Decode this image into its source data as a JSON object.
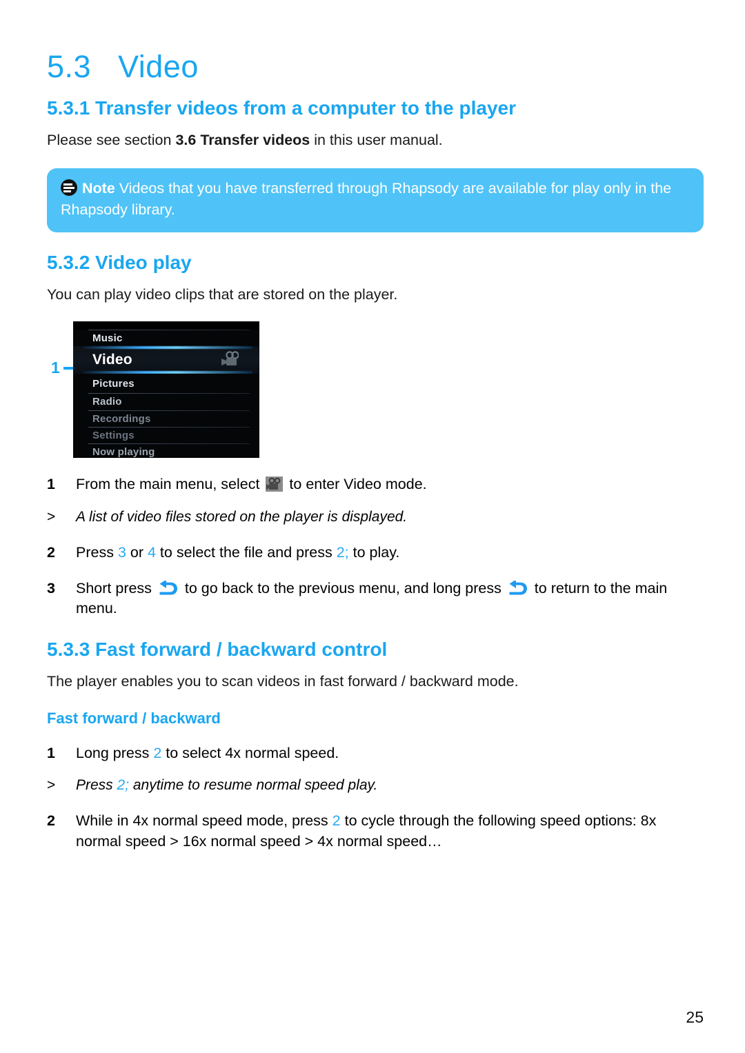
{
  "page": {
    "number": "25"
  },
  "section": {
    "title_number": "5.3",
    "title_text": "Video"
  },
  "sub_531": {
    "heading": "5.3.1 Transfer videos from a computer to the player",
    "body_before": "Please see section ",
    "body_bold": "3.6 Transfer videos",
    "body_after": " in this user manual."
  },
  "note": {
    "icon": "note-icon",
    "label": "Note",
    "text": " Videos that you have transferred through Rhapsody are available for play only in the Rhapsody library."
  },
  "sub_532": {
    "heading": "5.3.2 Video play",
    "intro": "You can play video clips that are stored on the player.",
    "figure": {
      "callout_number": "1",
      "menu_items": [
        {
          "label": "Music",
          "state": "normal"
        },
        {
          "label": "Video",
          "state": "selected",
          "icon": "video-camera-icon"
        },
        {
          "label": "Pictures",
          "state": "normal"
        },
        {
          "label": "Radio",
          "state": "dim"
        },
        {
          "label": "Recordings",
          "state": "dimmer"
        },
        {
          "label": "Settings",
          "state": "dimmer"
        },
        {
          "label": "Now playing",
          "state": "dim"
        }
      ]
    },
    "steps": [
      {
        "num": "1",
        "text_1": "From the main menu, select ",
        "icon": "video-camera-icon",
        "text_2": " to enter Video mode."
      },
      {
        "num": "2",
        "text_1": "Press ",
        "key_1": "3",
        "text_2": " or ",
        "key_2": "4",
        "text_3": " to select the file and press ",
        "key_3": "2;",
        "text_4": "  to play."
      },
      {
        "num": "3",
        "text_1": "Short press ",
        "icon_1": "back-arrow-icon",
        "text_2": " to go back to the previous menu, and long press ",
        "icon_2": "back-arrow-icon",
        "text_3": " to return to the main menu."
      }
    ],
    "substep_1": {
      "marker": ">",
      "text": "A list of video files stored on the player is displayed."
    }
  },
  "sub_533": {
    "heading": "5.3.3 Fast forward / backward control",
    "intro": "The player enables you to scan videos in fast forward / backward mode.",
    "subheading": "Fast forward / backward",
    "steps": [
      {
        "num": "1",
        "text_1": "Long press ",
        "key_1": "2",
        "text_2": " to select 4x normal speed."
      },
      {
        "num": "2",
        "text_1": "While in 4x normal speed mode, press ",
        "key_1": "2",
        "text_2": " to cycle through the following speed options: 8x normal speed > 16x normal speed > 4x normal speed…"
      }
    ],
    "substep_1": {
      "marker": ">",
      "text_1": "Press ",
      "key_1": "2;",
      "text_2": "  anytime to resume normal speed play."
    }
  },
  "colors": {
    "brand_blue": "#19A6F0",
    "note_bg": "#4FC3F7",
    "key_blue": "#29A8F0",
    "text": "#1a1a1a"
  }
}
